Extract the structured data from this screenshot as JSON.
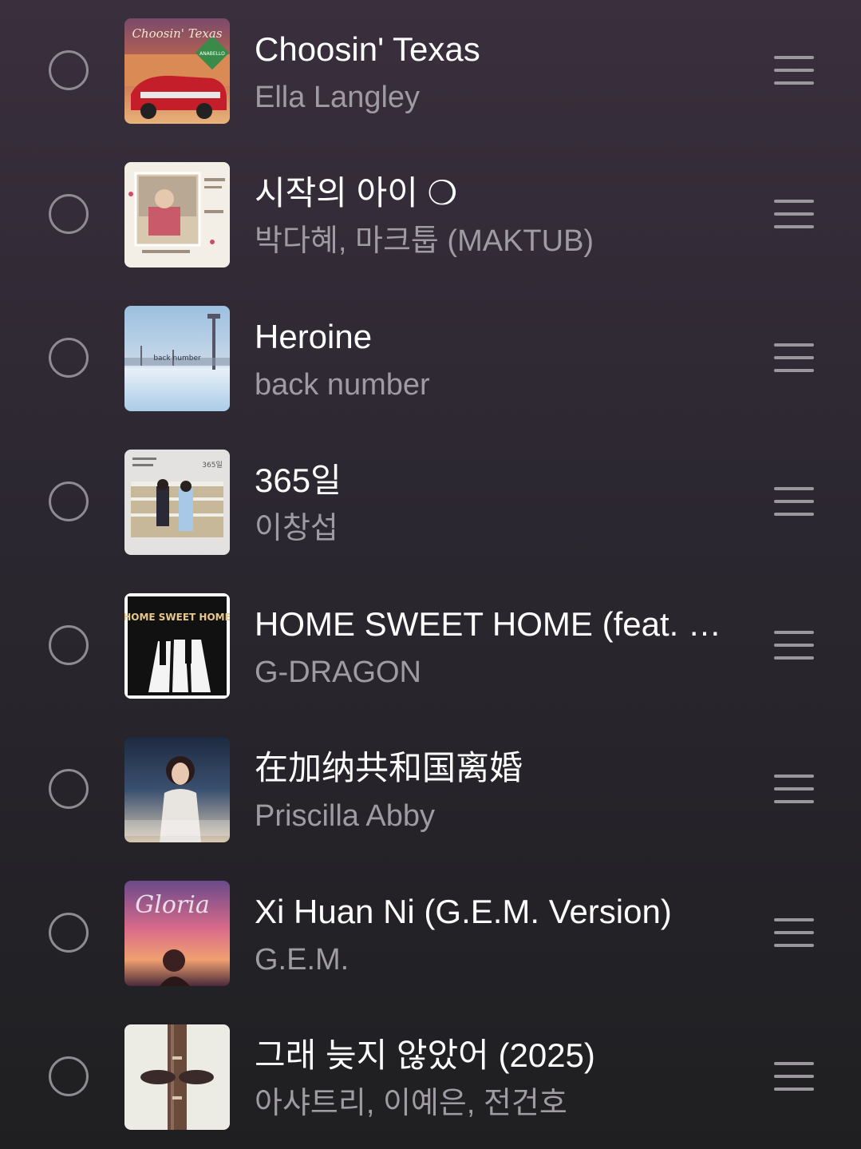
{
  "tracks": [
    {
      "title": "Choosin' Texas",
      "artist": "Ella Langley",
      "art_label": "Choosin' Texas",
      "art_badge": "ANABELLO"
    },
    {
      "title": "시작의 아이 ❍",
      "artist": "박다혜, 마크툽 (MAKTUB)"
    },
    {
      "title": "Heroine",
      "artist": "back number",
      "art_label": "back number"
    },
    {
      "title": "365일",
      "artist": "이창섭",
      "art_label": "365일"
    },
    {
      "title": "HOME SWEET HOME (feat. …",
      "artist": "G-DRAGON",
      "art_label": "HOME SWEET HOME"
    },
    {
      "title": "在加纳共和国离婚",
      "artist": "Priscilla Abby"
    },
    {
      "title": "Xi Huan Ni (G.E.M. Version)",
      "artist": "G.E.M.",
      "art_label": "Gloria"
    },
    {
      "title": "그래 늦지 않았어 (2025)",
      "artist": "아샤트리, 이예은, 전건호"
    }
  ],
  "icons": {
    "select": "radio-circle-icon",
    "drag": "drag-handle-icon"
  },
  "colors": {
    "title_text": "#ffffff",
    "artist_text": "#9e9ba2",
    "control_gray": "#8e8b92",
    "background_top": "#3a2f3d",
    "background_bottom": "#1f1f21"
  }
}
